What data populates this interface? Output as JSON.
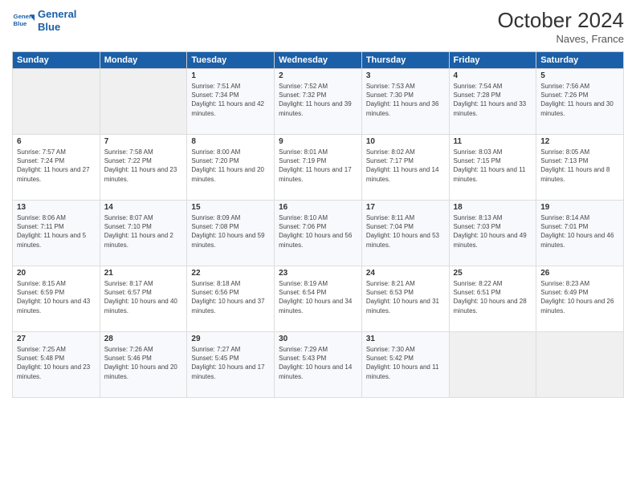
{
  "logo": {
    "line1": "General",
    "line2": "Blue"
  },
  "title": "October 2024",
  "location": "Naves, France",
  "days_header": [
    "Sunday",
    "Monday",
    "Tuesday",
    "Wednesday",
    "Thursday",
    "Friday",
    "Saturday"
  ],
  "weeks": [
    [
      {
        "num": "",
        "sunrise": "",
        "sunset": "",
        "daylight": ""
      },
      {
        "num": "",
        "sunrise": "",
        "sunset": "",
        "daylight": ""
      },
      {
        "num": "1",
        "sunrise": "Sunrise: 7:51 AM",
        "sunset": "Sunset: 7:34 PM",
        "daylight": "Daylight: 11 hours and 42 minutes."
      },
      {
        "num": "2",
        "sunrise": "Sunrise: 7:52 AM",
        "sunset": "Sunset: 7:32 PM",
        "daylight": "Daylight: 11 hours and 39 minutes."
      },
      {
        "num": "3",
        "sunrise": "Sunrise: 7:53 AM",
        "sunset": "Sunset: 7:30 PM",
        "daylight": "Daylight: 11 hours and 36 minutes."
      },
      {
        "num": "4",
        "sunrise": "Sunrise: 7:54 AM",
        "sunset": "Sunset: 7:28 PM",
        "daylight": "Daylight: 11 hours and 33 minutes."
      },
      {
        "num": "5",
        "sunrise": "Sunrise: 7:56 AM",
        "sunset": "Sunset: 7:26 PM",
        "daylight": "Daylight: 11 hours and 30 minutes."
      }
    ],
    [
      {
        "num": "6",
        "sunrise": "Sunrise: 7:57 AM",
        "sunset": "Sunset: 7:24 PM",
        "daylight": "Daylight: 11 hours and 27 minutes."
      },
      {
        "num": "7",
        "sunrise": "Sunrise: 7:58 AM",
        "sunset": "Sunset: 7:22 PM",
        "daylight": "Daylight: 11 hours and 23 minutes."
      },
      {
        "num": "8",
        "sunrise": "Sunrise: 8:00 AM",
        "sunset": "Sunset: 7:20 PM",
        "daylight": "Daylight: 11 hours and 20 minutes."
      },
      {
        "num": "9",
        "sunrise": "Sunrise: 8:01 AM",
        "sunset": "Sunset: 7:19 PM",
        "daylight": "Daylight: 11 hours and 17 minutes."
      },
      {
        "num": "10",
        "sunrise": "Sunrise: 8:02 AM",
        "sunset": "Sunset: 7:17 PM",
        "daylight": "Daylight: 11 hours and 14 minutes."
      },
      {
        "num": "11",
        "sunrise": "Sunrise: 8:03 AM",
        "sunset": "Sunset: 7:15 PM",
        "daylight": "Daylight: 11 hours and 11 minutes."
      },
      {
        "num": "12",
        "sunrise": "Sunrise: 8:05 AM",
        "sunset": "Sunset: 7:13 PM",
        "daylight": "Daylight: 11 hours and 8 minutes."
      }
    ],
    [
      {
        "num": "13",
        "sunrise": "Sunrise: 8:06 AM",
        "sunset": "Sunset: 7:11 PM",
        "daylight": "Daylight: 11 hours and 5 minutes."
      },
      {
        "num": "14",
        "sunrise": "Sunrise: 8:07 AM",
        "sunset": "Sunset: 7:10 PM",
        "daylight": "Daylight: 11 hours and 2 minutes."
      },
      {
        "num": "15",
        "sunrise": "Sunrise: 8:09 AM",
        "sunset": "Sunset: 7:08 PM",
        "daylight": "Daylight: 10 hours and 59 minutes."
      },
      {
        "num": "16",
        "sunrise": "Sunrise: 8:10 AM",
        "sunset": "Sunset: 7:06 PM",
        "daylight": "Daylight: 10 hours and 56 minutes."
      },
      {
        "num": "17",
        "sunrise": "Sunrise: 8:11 AM",
        "sunset": "Sunset: 7:04 PM",
        "daylight": "Daylight: 10 hours and 53 minutes."
      },
      {
        "num": "18",
        "sunrise": "Sunrise: 8:13 AM",
        "sunset": "Sunset: 7:03 PM",
        "daylight": "Daylight: 10 hours and 49 minutes."
      },
      {
        "num": "19",
        "sunrise": "Sunrise: 8:14 AM",
        "sunset": "Sunset: 7:01 PM",
        "daylight": "Daylight: 10 hours and 46 minutes."
      }
    ],
    [
      {
        "num": "20",
        "sunrise": "Sunrise: 8:15 AM",
        "sunset": "Sunset: 6:59 PM",
        "daylight": "Daylight: 10 hours and 43 minutes."
      },
      {
        "num": "21",
        "sunrise": "Sunrise: 8:17 AM",
        "sunset": "Sunset: 6:57 PM",
        "daylight": "Daylight: 10 hours and 40 minutes."
      },
      {
        "num": "22",
        "sunrise": "Sunrise: 8:18 AM",
        "sunset": "Sunset: 6:56 PM",
        "daylight": "Daylight: 10 hours and 37 minutes."
      },
      {
        "num": "23",
        "sunrise": "Sunrise: 8:19 AM",
        "sunset": "Sunset: 6:54 PM",
        "daylight": "Daylight: 10 hours and 34 minutes."
      },
      {
        "num": "24",
        "sunrise": "Sunrise: 8:21 AM",
        "sunset": "Sunset: 6:53 PM",
        "daylight": "Daylight: 10 hours and 31 minutes."
      },
      {
        "num": "25",
        "sunrise": "Sunrise: 8:22 AM",
        "sunset": "Sunset: 6:51 PM",
        "daylight": "Daylight: 10 hours and 28 minutes."
      },
      {
        "num": "26",
        "sunrise": "Sunrise: 8:23 AM",
        "sunset": "Sunset: 6:49 PM",
        "daylight": "Daylight: 10 hours and 26 minutes."
      }
    ],
    [
      {
        "num": "27",
        "sunrise": "Sunrise: 7:25 AM",
        "sunset": "Sunset: 5:48 PM",
        "daylight": "Daylight: 10 hours and 23 minutes."
      },
      {
        "num": "28",
        "sunrise": "Sunrise: 7:26 AM",
        "sunset": "Sunset: 5:46 PM",
        "daylight": "Daylight: 10 hours and 20 minutes."
      },
      {
        "num": "29",
        "sunrise": "Sunrise: 7:27 AM",
        "sunset": "Sunset: 5:45 PM",
        "daylight": "Daylight: 10 hours and 17 minutes."
      },
      {
        "num": "30",
        "sunrise": "Sunrise: 7:29 AM",
        "sunset": "Sunset: 5:43 PM",
        "daylight": "Daylight: 10 hours and 14 minutes."
      },
      {
        "num": "31",
        "sunrise": "Sunrise: 7:30 AM",
        "sunset": "Sunset: 5:42 PM",
        "daylight": "Daylight: 10 hours and 11 minutes."
      },
      {
        "num": "",
        "sunrise": "",
        "sunset": "",
        "daylight": ""
      },
      {
        "num": "",
        "sunrise": "",
        "sunset": "",
        "daylight": ""
      }
    ]
  ]
}
